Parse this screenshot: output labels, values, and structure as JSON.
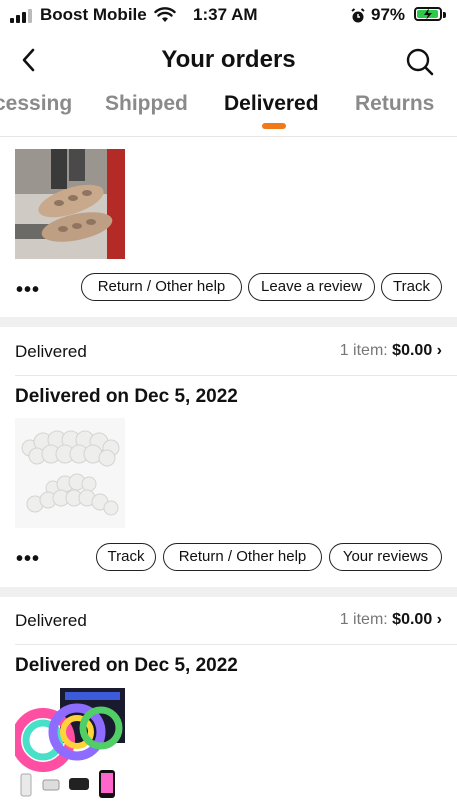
{
  "status_bar": {
    "carrier": "Boost Mobile",
    "time": "1:37 AM",
    "battery": "97%",
    "battery_level": 0.97,
    "icons": [
      "signal-icon",
      "wifi-icon",
      "alarm-icon",
      "battery-icon"
    ]
  },
  "header": {
    "title": "Your orders",
    "back_icon": "chevron-left-icon",
    "search_icon": "search-icon"
  },
  "tabs": {
    "items": [
      "cessing",
      "Shipped",
      "Delivered",
      "Returns"
    ],
    "active": "Delivered"
  },
  "colors": {
    "accent": "#f07a1a",
    "battery": "#2ec94a"
  },
  "orders": [
    {
      "actions": {
        "more": "•••",
        "buttons": [
          "Return / Other help",
          "Leave a review",
          "Track"
        ]
      }
    },
    {
      "status": "Delivered",
      "item_count": "1 item:",
      "amount": "$0.00",
      "delivered_on": "Delivered on Dec 5, 2022",
      "actions": {
        "more": "•••",
        "buttons": [
          "Track",
          "Return / Other help",
          "Your reviews"
        ]
      }
    },
    {
      "status": "Delivered",
      "item_count": "1 item:",
      "amount": "$0.00",
      "delivered_on": "Delivered on Dec 5, 2022"
    }
  ]
}
